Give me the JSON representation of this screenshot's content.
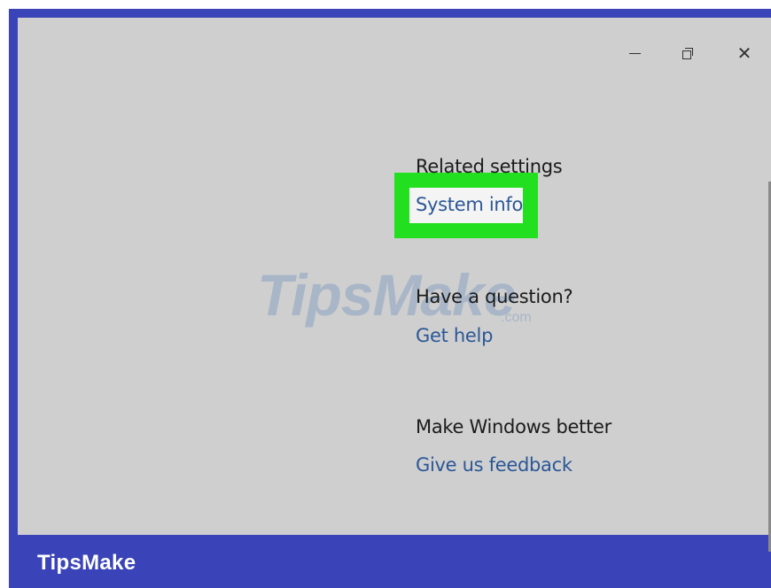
{
  "window": {
    "controls": {
      "minimize_icon": "minimize-icon",
      "restore_icon": "restore-icon",
      "close_icon": "close-icon",
      "close_glyph": "✕"
    }
  },
  "related_settings": {
    "heading": "Related settings",
    "link": "System info"
  },
  "help": {
    "heading": "Have a question?",
    "link": "Get help"
  },
  "feedback": {
    "heading": "Make Windows better",
    "link": "Give us feedback"
  },
  "watermark": {
    "text": "TipsMake",
    "suffix": ".com"
  },
  "footer": {
    "brand": "TipsMake"
  },
  "colors": {
    "frame": "#3a44b8",
    "window_bg": "#cfcfcf",
    "link": "#2b5797",
    "highlight": "#22e01f"
  }
}
